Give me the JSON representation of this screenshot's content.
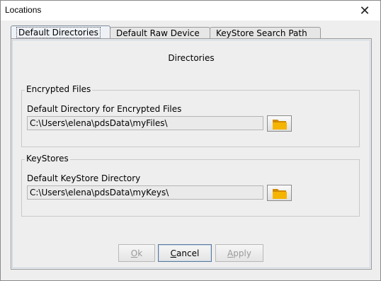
{
  "window": {
    "title": "Locations"
  },
  "tabs": [
    {
      "label": "Default Directories",
      "active": true
    },
    {
      "label": "Default Raw Device",
      "active": false
    },
    {
      "label": "KeyStore Search Path",
      "active": false
    }
  ],
  "panel": {
    "heading": "Directories",
    "encrypted_files": {
      "group_title": "Encrypted Files",
      "field_label": "Default Directory for Encrypted Files",
      "path": "C:\\Users\\elena\\pdsData\\myFiles\\"
    },
    "keystores": {
      "group_title": "KeyStores",
      "field_label": "Default KeyStore Directory",
      "path": "C:\\Users\\elena\\pdsData\\myKeys\\"
    }
  },
  "buttons": {
    "ok": {
      "mnemonic": "O",
      "rest": "k",
      "enabled": false
    },
    "cancel": {
      "mnemonic": "C",
      "rest": "ancel",
      "enabled": true
    },
    "apply": {
      "mnemonic": "A",
      "rest": "pply",
      "enabled": false
    }
  },
  "icons": {
    "close": "close-icon",
    "folder": "folder-icon"
  },
  "colors": {
    "folder_fill": "#f5b400",
    "folder_dark": "#d08a00"
  }
}
